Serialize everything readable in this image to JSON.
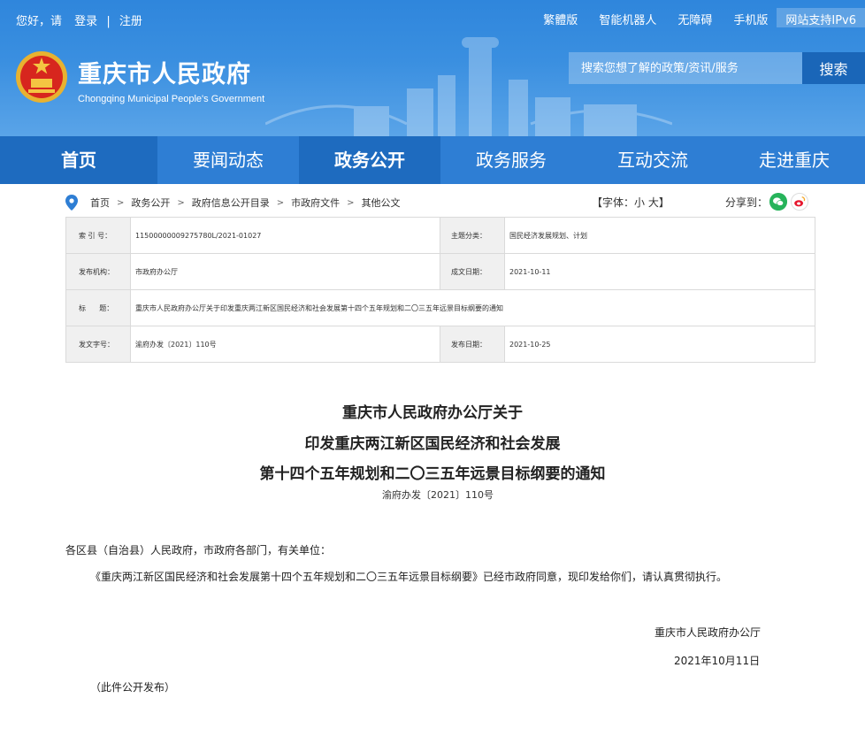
{
  "topbar": {
    "greeting": "您好，请",
    "login": "登录",
    "separator": "|",
    "register": "注册",
    "links": [
      "繁體版",
      "智能机器人",
      "无障碍",
      "手机版"
    ],
    "ipv6": "网站支持IPv6"
  },
  "header": {
    "title": "重庆市人民政府",
    "subtitle": "Chongqing Municipal People's Government"
  },
  "search": {
    "placeholder": "搜索您想了解的政策/资讯/服务",
    "button": "搜索"
  },
  "nav": [
    "首页",
    "要闻动态",
    "政务公开",
    "政务服务",
    "互动交流",
    "走进重庆"
  ],
  "nav_active": "政务公开",
  "breadcrumb": [
    "首页",
    "政务公开",
    "政府信息公开目录",
    "市政府文件",
    "其他公文"
  ],
  "breadcrumb_arrow": ">",
  "font_size_label": "【字体：小 大】",
  "share_label": "分享到：",
  "info": {
    "index_label": "索 引 号：",
    "index_value": "11500000009275780L/2021-01027",
    "topic_label": "主题分类：",
    "topic_value": "国民经济发展规划、计划",
    "issuer_label": "发布机构：",
    "issuer_value": "市政府办公厅",
    "written_label": "成文日期：",
    "written_value": "2021-10-11",
    "title_label": "标      题：",
    "title_value": "重庆市人民政府办公厅关于印发重庆两江新区国民经济和社会发展第十四个五年规划和二〇三五年远景目标纲要的通知",
    "docno_label": "发文字号：",
    "docno_value": "渝府办发〔2021〕110号",
    "publish_label": "发布日期：",
    "publish_value": "2021-10-25"
  },
  "document": {
    "title_lines": [
      "重庆市人民政府办公厅关于",
      "印发重庆两江新区国民经济和社会发展",
      "第十四个五年规划和二〇三五年远景目标纲要的通知"
    ],
    "number": "渝府办发〔2021〕110号",
    "salutation": "各区县（自治县）人民政府，市政府各部门，有关单位：",
    "body": "《重庆两江新区国民经济和社会发展第十四个五年规划和二〇三五年远景目标纲要》已经市政府同意，现印发给你们，请认真贯彻执行。",
    "signature": "重庆市人民政府办公厅",
    "date": "2021年10月11日",
    "note": "（此件公开发布）"
  }
}
